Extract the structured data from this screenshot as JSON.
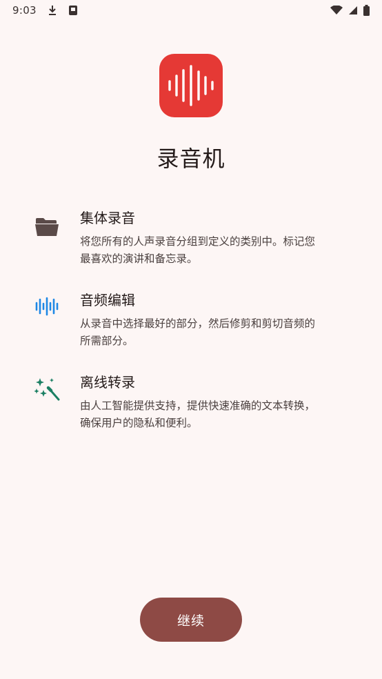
{
  "status_bar": {
    "time": "9:03",
    "icons": [
      "download-icon",
      "card-icon",
      "wifi-icon",
      "signal-icon",
      "battery-icon"
    ]
  },
  "app": {
    "icon": "waveform-icon",
    "icon_color": "#e53935",
    "title": "录音机"
  },
  "features": [
    {
      "icon": "folder-icon",
      "icon_color": "#5a4a48",
      "title": "集体录音",
      "desc_line1": "将您所有的人声录音分组到定义的类别中。标记您",
      "desc_line2": "最喜欢的演讲和备忘录。"
    },
    {
      "icon": "audio-wave-icon",
      "icon_color": "#1e88e5",
      "title": "音频编辑",
      "desc_line1": "从录音中选择最好的部分，然后修剪和剪切音频的",
      "desc_line2": "所需部分。"
    },
    {
      "icon": "magic-wand-icon",
      "icon_color": "#1b7f63",
      "title": "离线转录",
      "desc_line1": "由人工智能提供支持，提供快速准确的文本转换，",
      "desc_line2": "确保用户的隐私和便利。"
    }
  ],
  "continue_button": {
    "label": "继续",
    "color": "#8e4a45"
  }
}
